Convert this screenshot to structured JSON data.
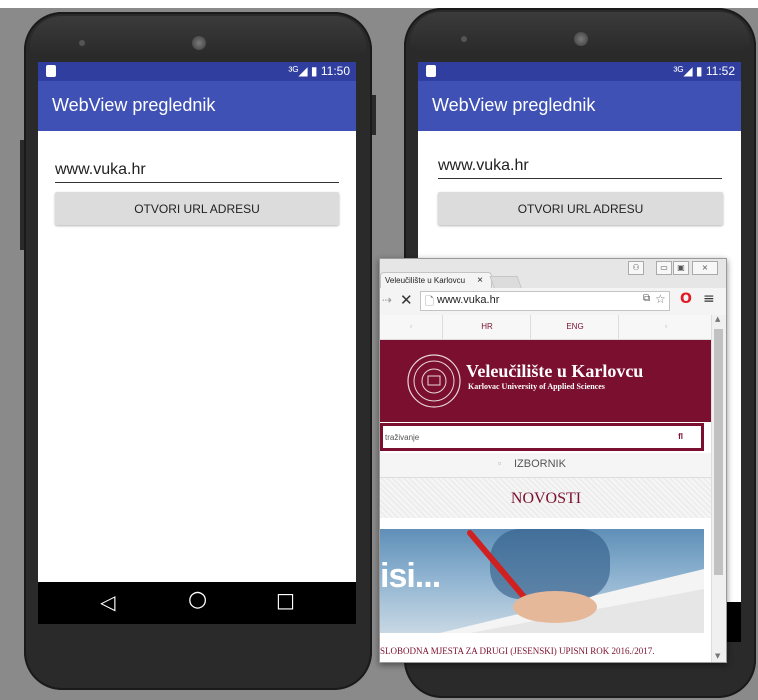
{
  "left_phone": {
    "status_time": "11:50",
    "app_title": "WebView preglednik",
    "url_value": "www.vuka.hr",
    "open_button_label": "OTVORI URL ADRESU",
    "nav": {
      "back_icon": "◁",
      "home_icon": "○",
      "recents_icon": "□"
    }
  },
  "right_phone": {
    "status_time": "11:52",
    "app_title": "WebView preglednik",
    "url_value": "www.vuka.hr",
    "open_button_label": "OTVORI URL ADRESU"
  },
  "browser": {
    "tab_title": "Veleučilište u Karlovcu",
    "tab_close": "×",
    "url": "www.vuka.hr",
    "lang_hr": "HR",
    "lang_eng": "ENG",
    "university_name": "Veleučilište u Karlovcu",
    "university_subtitle": "Karlovac University of Applied Sciences",
    "search_placeholder": "traživanje",
    "search_icon": "fl",
    "menu_label": "IZBORNIK",
    "news_heading": "NOVOSTI",
    "hero_text": "isi...",
    "news_item": "SLOBODNA MJESTA ZA DRUGI (JESENSKI) UPISNI ROK 2016./2017."
  },
  "colors": {
    "app_bar": "#3f51b5",
    "status_bar": "#303f9f",
    "university_maroon": "#7b0f2f"
  }
}
